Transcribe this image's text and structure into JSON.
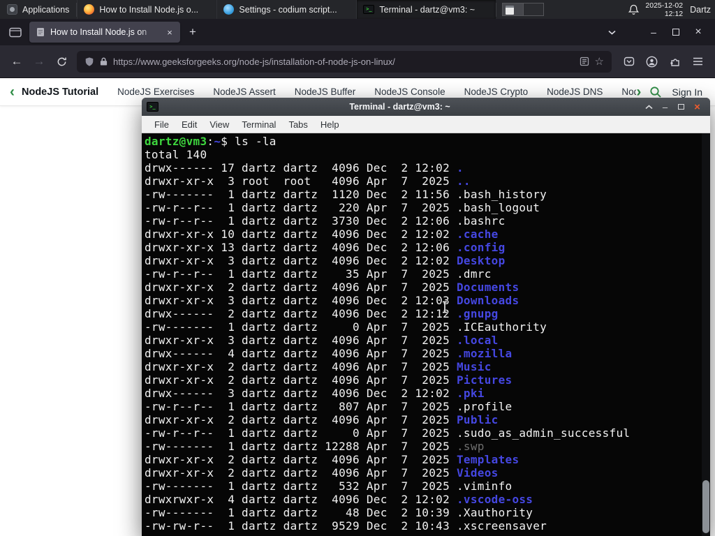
{
  "panel": {
    "applications_label": "Applications",
    "tasks": [
      {
        "label": "How to Install Node.js o...",
        "icon": "firefox",
        "active": false
      },
      {
        "label": "Settings - codium script...",
        "icon": "codium",
        "active": false
      },
      {
        "label": "Terminal - dartz@vm3: ~",
        "icon": "terminal",
        "active": true
      }
    ],
    "clock_date": "2025-12-02",
    "clock_time": "12:12",
    "user_label": "Dartz"
  },
  "browser": {
    "tab_title": "How to Install Node.js on",
    "url": "https://www.geeksforgeeks.org/node-js/installation-of-node-js-on-linux/"
  },
  "site_nav": {
    "items": [
      "NodeJS Tutorial",
      "NodeJS Exercises",
      "NodeJS Assert",
      "NodeJS Buffer",
      "NodeJS Console",
      "NodeJS Crypto",
      "NodeJS DNS",
      "Node"
    ],
    "sign_in_label": "Sign In",
    "accent": "#2f8d46"
  },
  "terminal": {
    "title": "Terminal - dartz@vm3: ~",
    "menu": [
      "File",
      "Edit",
      "View",
      "Terminal",
      "Tabs",
      "Help"
    ],
    "prompt": {
      "user_host": "dartz@vm3",
      "colon": ":",
      "path": "~",
      "dollar": "$",
      "command": "ls -la"
    },
    "total_line": "total 140",
    "colors": {
      "bg": "#060606",
      "text": "#f2f2f2",
      "prompt_green": "#3ed63e",
      "dir_blue": "#4547e2",
      "dim": "#6e6e6e"
    },
    "rows": [
      [
        "drwx------ 17 dartz dartz  4096 Dec  2 12:02 ",
        ".",
        "d"
      ],
      [
        "drwxr-xr-x  3 root  root   4096 Apr  7  2025 ",
        "..",
        "d"
      ],
      [
        "-rw-------  1 dartz dartz  1120 Dec  2 11:56 ",
        ".bash_history",
        "f"
      ],
      [
        "-rw-r--r--  1 dartz dartz   220 Apr  7  2025 ",
        ".bash_logout",
        "f"
      ],
      [
        "-rw-r--r--  1 dartz dartz  3730 Dec  2 12:06 ",
        ".bashrc",
        "f"
      ],
      [
        "drwxr-xr-x 10 dartz dartz  4096 Dec  2 12:02 ",
        ".cache",
        "d"
      ],
      [
        "drwxr-xr-x 13 dartz dartz  4096 Dec  2 12:06 ",
        ".config",
        "d"
      ],
      [
        "drwxr-xr-x  3 dartz dartz  4096 Dec  2 12:02 ",
        "Desktop",
        "d"
      ],
      [
        "-rw-r--r--  1 dartz dartz    35 Apr  7  2025 ",
        ".dmrc",
        "f"
      ],
      [
        "drwxr-xr-x  2 dartz dartz  4096 Apr  7  2025 ",
        "Documents",
        "d"
      ],
      [
        "drwxr-xr-x  3 dartz dartz  4096 Dec  2 12:03 ",
        "Downloads",
        "d"
      ],
      [
        "drwx------  2 dartz dartz  4096 Dec  2 12:12 ",
        ".gnupg",
        "d"
      ],
      [
        "-rw-------  1 dartz dartz     0 Apr  7  2025 ",
        ".ICEauthority",
        "f"
      ],
      [
        "drwxr-xr-x  3 dartz dartz  4096 Apr  7  2025 ",
        ".local",
        "d"
      ],
      [
        "drwx------  4 dartz dartz  4096 Apr  7  2025 ",
        ".mozilla",
        "d"
      ],
      [
        "drwxr-xr-x  2 dartz dartz  4096 Apr  7  2025 ",
        "Music",
        "d"
      ],
      [
        "drwxr-xr-x  2 dartz dartz  4096 Apr  7  2025 ",
        "Pictures",
        "d"
      ],
      [
        "drwx------  3 dartz dartz  4096 Dec  2 12:02 ",
        ".pki",
        "d"
      ],
      [
        "-rw-r--r--  1 dartz dartz   807 Apr  7  2025 ",
        ".profile",
        "f"
      ],
      [
        "drwxr-xr-x  2 dartz dartz  4096 Apr  7  2025 ",
        "Public",
        "d"
      ],
      [
        "-rw-r--r--  1 dartz dartz     0 Apr  7  2025 ",
        ".sudo_as_admin_successful",
        "f"
      ],
      [
        "-rw-------  1 dartz dartz 12288 Apr  7  2025 ",
        ".swp",
        "x"
      ],
      [
        "drwxr-xr-x  2 dartz dartz  4096 Apr  7  2025 ",
        "Templates",
        "d"
      ],
      [
        "drwxr-xr-x  2 dartz dartz  4096 Apr  7  2025 ",
        "Videos",
        "d"
      ],
      [
        "-rw-------  1 dartz dartz   532 Apr  7  2025 ",
        ".viminfo",
        "f"
      ],
      [
        "drwxrwxr-x  4 dartz dartz  4096 Dec  2 12:02 ",
        ".vscode-oss",
        "d"
      ],
      [
        "-rw-------  1 dartz dartz    48 Dec  2 10:39 ",
        ".Xauthority",
        "f"
      ],
      [
        "-rw-rw-r--  1 dartz dartz  9529 Dec  2 10:43 ",
        ".xscreensaver",
        "f"
      ]
    ]
  },
  "glyphs": {
    "back": "←",
    "forward": "→",
    "new_tab": "+",
    "close": "×",
    "minimize": "–",
    "star": "☆",
    "nav_prev": "‹",
    "nav_next": "›"
  }
}
